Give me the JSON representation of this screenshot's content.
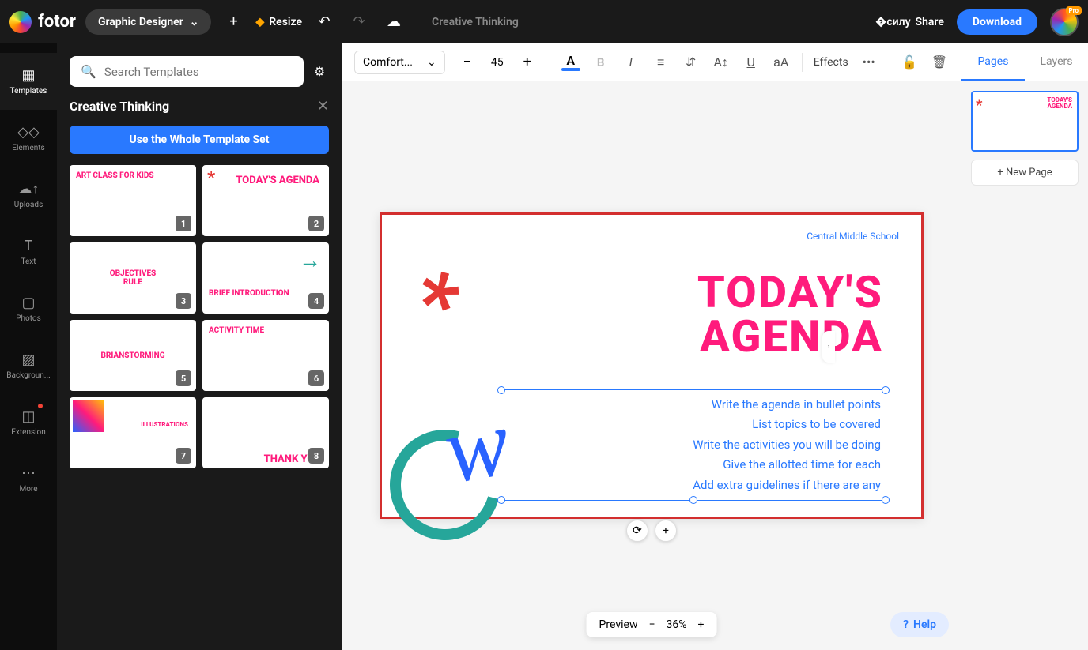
{
  "brand": "fotor",
  "role": "Graphic Designer",
  "resize": "Resize",
  "docTitle": "Creative Thinking",
  "share": "Share",
  "download": "Download",
  "pro": "Pro",
  "rail": [
    {
      "label": "Templates"
    },
    {
      "label": "Elements"
    },
    {
      "label": "Uploads"
    },
    {
      "label": "Text"
    },
    {
      "label": "Photos"
    },
    {
      "label": "Backgroun..."
    },
    {
      "label": "Extension"
    },
    {
      "label": "More"
    }
  ],
  "searchPlaceholder": "Search Templates",
  "panelTitle": "Creative Thinking",
  "useBtn": "Use the Whole Template Set",
  "thumbs": [
    {
      "n": "1",
      "txt": "ART CLASS FOR KIDS"
    },
    {
      "n": "2",
      "txt": "TODAY'S AGENDA"
    },
    {
      "n": "3",
      "txt": "OBJECTIVES\nRULE"
    },
    {
      "n": "4",
      "txt": "BRIEF INTRODUCTION"
    },
    {
      "n": "5",
      "txt": "BRIANSTORMING"
    },
    {
      "n": "6",
      "txt": "ACTIVITY TIME"
    },
    {
      "n": "7",
      "txt": "ILLUSTRATIONS"
    },
    {
      "n": "8",
      "txt": "THANK YOU"
    }
  ],
  "font": "Comfort...",
  "fontSize": "45",
  "effects": "Effects",
  "slide": {
    "label": "Central Middle School",
    "title1": "TODAY'S",
    "title2": "AGENDA",
    "scribble": "w",
    "lines": [
      "Write the agenda in bullet points",
      "List topics to be covered",
      "Write the activities you will be doing",
      "Give the allotted time for each",
      "Add extra guidelines if there are any"
    ]
  },
  "preview": "Preview",
  "zoom": "36%",
  "help": "Help",
  "tabs": {
    "pages": "Pages",
    "layers": "Layers"
  },
  "newPage": "New Page"
}
